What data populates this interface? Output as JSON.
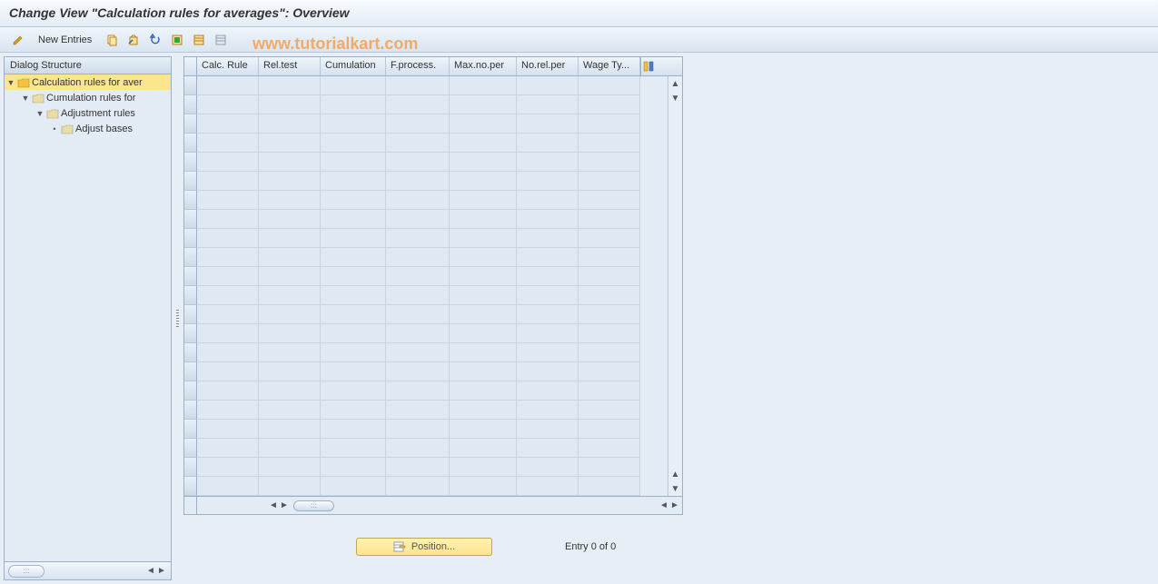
{
  "title": "Change View \"Calculation rules for averages\": Overview",
  "toolbar": {
    "new_entries": "New Entries"
  },
  "watermark": "www.tutorialkart.com",
  "sidebar": {
    "header": "Dialog Structure",
    "tree": [
      {
        "label": "Calculation rules for aver",
        "indent": 0,
        "open": true,
        "selected": true,
        "leaf": false
      },
      {
        "label": "Cumulation rules for",
        "indent": 1,
        "open": false,
        "selected": false,
        "leaf": false
      },
      {
        "label": "Adjustment rules",
        "indent": 2,
        "open": false,
        "selected": false,
        "leaf": false
      },
      {
        "label": "Adjust bases",
        "indent": 3,
        "open": false,
        "selected": false,
        "leaf": true
      }
    ]
  },
  "table": {
    "columns": [
      "Calc. Rule",
      "Rel.test",
      "Cumulation",
      "F.process.",
      "Max.no.per",
      "No.rel.per",
      "Wage Ty..."
    ],
    "row_count": 22
  },
  "footer": {
    "position_label": "Position...",
    "entry_text": "Entry 0 of 0"
  }
}
